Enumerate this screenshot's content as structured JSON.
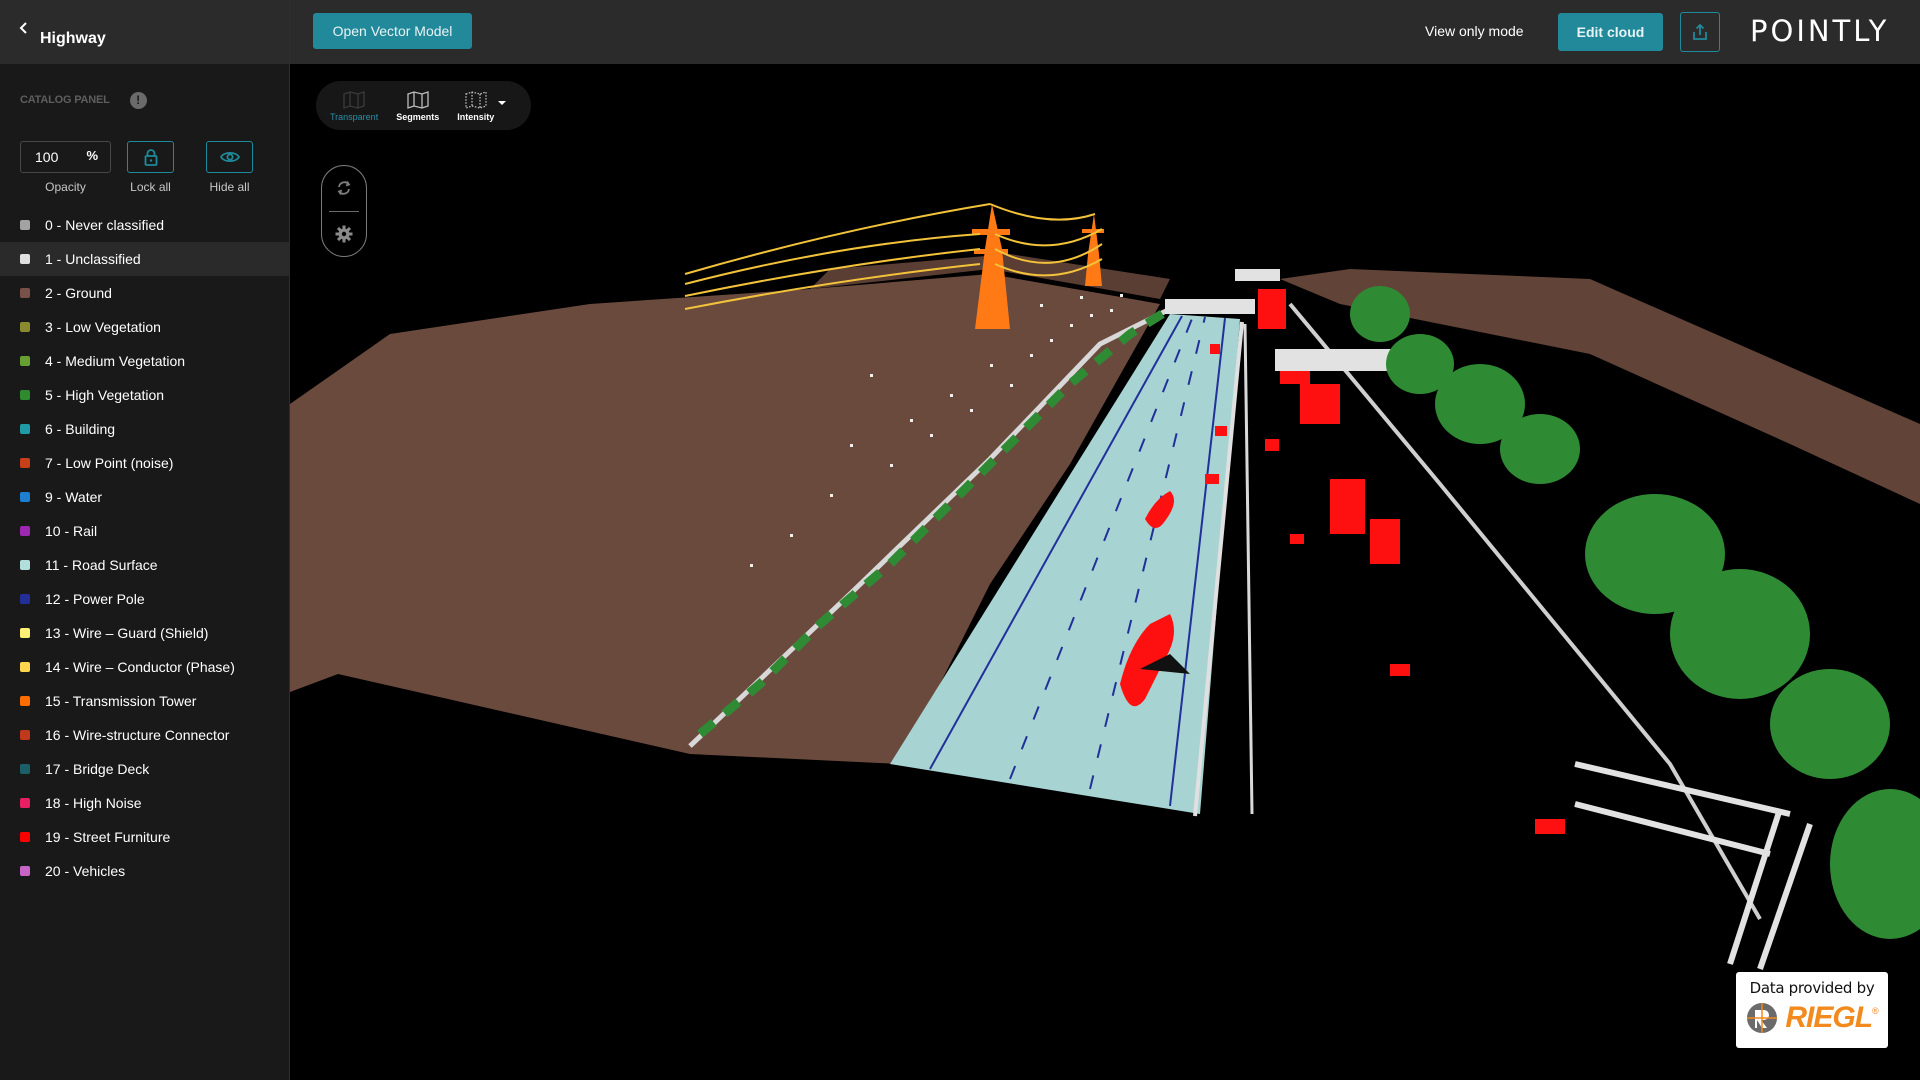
{
  "sidebar": {
    "back_icon": "chevron-left-icon",
    "title": "Highway",
    "catalog_label": "CATALOG PANEL",
    "info_icon_glyph": "!",
    "opacity": {
      "value": "100",
      "unit": "%",
      "label": "Opacity"
    },
    "lock_all_label": "Lock all",
    "hide_all_label": "Hide all",
    "classes": [
      {
        "label": "0 - Never classified",
        "color": "#a3a3a3"
      },
      {
        "label": "1 - Unclassified",
        "color": "#e0e0e0",
        "selected": true
      },
      {
        "label": "2 - Ground",
        "color": "#7a5148"
      },
      {
        "label": "3 - Low Vegetation",
        "color": "#8a8a2e"
      },
      {
        "label": "4 - Medium Vegetation",
        "color": "#67a032"
      },
      {
        "label": "5 - High Vegetation",
        "color": "#2e8b2e"
      },
      {
        "label": "6 - Building",
        "color": "#1f9aa6"
      },
      {
        "label": "7 - Low Point (noise)",
        "color": "#c8401a"
      },
      {
        "label": "9 - Water",
        "color": "#1e7fd0"
      },
      {
        "label": "10 - Rail",
        "color": "#9c27b0"
      },
      {
        "label": "11 - Road Surface",
        "color": "#b2dfdb"
      },
      {
        "label": "12 - Power Pole",
        "color": "#232f96"
      },
      {
        "label": "13 - Wire – Guard (Shield)",
        "color": "#fff176"
      },
      {
        "label": "14 - Wire – Conductor (Phase)",
        "color": "#ffd54f"
      },
      {
        "label": "15 - Transmission Tower",
        "color": "#ff6d00"
      },
      {
        "label": "16 - Wire-structure Connector",
        "color": "#c0391b"
      },
      {
        "label": "17 - Bridge Deck",
        "color": "#1b6066"
      },
      {
        "label": "18 - High Noise",
        "color": "#e91e63"
      },
      {
        "label": "19 - Street Furniture",
        "color": "#ff0000"
      },
      {
        "label": "20 - Vehicles",
        "color": "#c765c7"
      }
    ]
  },
  "topbar": {
    "open_vector_label": "Open Vector Model",
    "view_mode_label": "View only mode",
    "edit_cloud_label": "Edit cloud",
    "share_icon": "share-upload-icon",
    "logo_text": "POINTLY"
  },
  "viewer": {
    "toolbar": [
      {
        "label": "Transparent",
        "icon": "map-icon",
        "active": true
      },
      {
        "label": "Segments",
        "icon": "map-icon",
        "active": false
      },
      {
        "label": "Intensity",
        "icon": "map-dotted-icon",
        "active": false
      }
    ],
    "nav": {
      "rotate_icon": "rotate-icon",
      "settings_icon": "gear-icon"
    },
    "credit": {
      "text": "Data provided by",
      "brand": "RIEGL",
      "registered": "®"
    }
  },
  "colors": {
    "accent": "#21899a",
    "ground": "#6b4a3e",
    "road": "#a7d3d3",
    "lane": "#22309a",
    "vegetation": "#2f8a34",
    "tower": "#ff7a14",
    "wire": "#f2c23a",
    "furniture": "#ff1010",
    "structure": "#e2e2e2"
  }
}
